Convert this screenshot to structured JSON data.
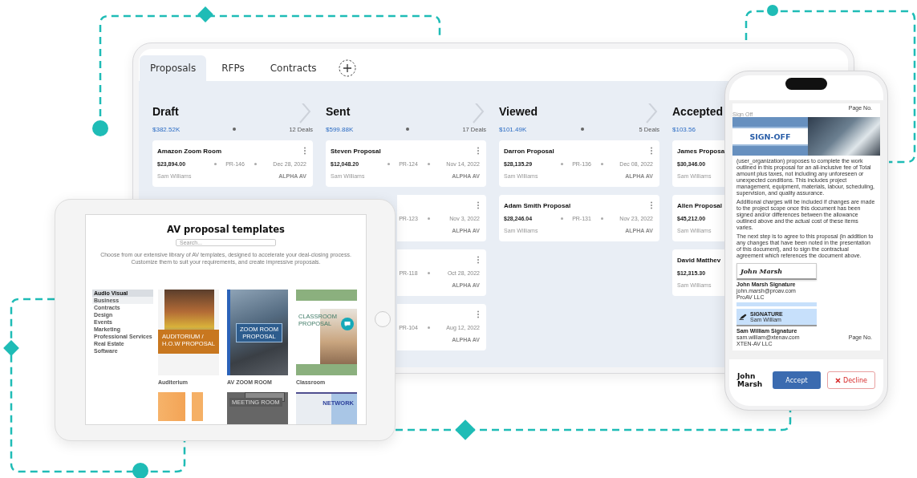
{
  "laptop": {
    "tabs": [
      {
        "label": "Proposals",
        "selected": true
      },
      {
        "label": "RFPs",
        "selected": false
      },
      {
        "label": "Contracts",
        "selected": false
      }
    ],
    "columns": [
      {
        "title": "Draft",
        "total": "$382.52K",
        "deals": "12 Deals",
        "cards": [
          {
            "title": "Amazon Zoom Room",
            "amount": "$23,894.00",
            "ref": "PR-146",
            "date": "Dec 28, 2022",
            "owner": "Sam Williams",
            "company": "ALPHA AV"
          }
        ]
      },
      {
        "title": "Sent",
        "total": "$599.88K",
        "deals": "17 Deals",
        "cards": [
          {
            "title": "Steven Proposal",
            "amount": "$12,048.20",
            "ref": "PR-124",
            "date": "Nov 14, 2022",
            "owner": "Sam Williams",
            "company": "ALPHA AV"
          },
          {
            "ref": "PR-123",
            "date": "Nov 3, 2022",
            "company": "ALPHA AV"
          },
          {
            "ref": "PR-118",
            "date": "Oct 28, 2022",
            "company": "ALPHA AV"
          },
          {
            "ref": "PR-104",
            "date": "Aug 12, 2022",
            "company": "ALPHA AV"
          }
        ]
      },
      {
        "title": "Viewed",
        "total": "$101.49K",
        "deals": "5 Deals",
        "cards": [
          {
            "title": "Darron Proposal",
            "amount": "$28,135.29",
            "ref": "PR-136",
            "date": "Dec 08, 2022",
            "owner": "Sam Williams",
            "company": "ALPHA AV"
          },
          {
            "title": "Adam Smith Proposal",
            "amount": "$28,246.04",
            "ref": "PR-131",
            "date": "Nov 23, 2022",
            "owner": "Sam Williams",
            "company": "ALPHA AV"
          }
        ]
      },
      {
        "title": "Accepted",
        "total": "$103.56",
        "cards": [
          {
            "title": "James Proposa",
            "amount": "$30,346.00",
            "owner": "Sam Williams"
          },
          {
            "title": "Allen Proposal",
            "amount": "$45,212.00",
            "owner": "Sam Williams"
          },
          {
            "title": "David Matthev",
            "amount": "$12,315.30",
            "owner": "Sam Williams"
          }
        ]
      }
    ]
  },
  "tablet": {
    "title": "AV proposal templates",
    "search": {
      "placeholder": "Search..."
    },
    "description": "Choose from our extensive library of AV templates, designed to accelerate your deal-closing process. Customize them to suit your requirements, and create impressive proposals.",
    "categories": [
      {
        "label": "Audio Visual",
        "selected": true,
        "hovered": false
      },
      {
        "label": "Business",
        "selected": false,
        "hovered": true
      },
      {
        "label": "Contracts",
        "selected": false,
        "hovered": false
      },
      {
        "label": "Design",
        "selected": false,
        "hovered": false
      },
      {
        "label": "Events",
        "selected": false,
        "hovered": false
      },
      {
        "label": "Marketing",
        "selected": false,
        "hovered": false
      },
      {
        "label": "Professional Services",
        "selected": false,
        "hovered": false
      },
      {
        "label": "Real Estate",
        "selected": false,
        "hovered": false
      },
      {
        "label": "Software",
        "selected": false,
        "hovered": false
      }
    ],
    "templates": [
      {
        "kind": "auditorium",
        "cover_text": "AUDITORIUM / H.O.W PROPOSAL",
        "name": "Auditerium"
      },
      {
        "kind": "zoom",
        "cover_text": "ZOOM ROOM PROPOSAL",
        "name": "AV ZOOM ROOM"
      },
      {
        "kind": "classroom",
        "cover_text": "CLASSROOM PROPOSAL",
        "name": "Classroom"
      },
      {
        "kind": "office"
      },
      {
        "kind": "meeting",
        "cover_text": "MEETING ROOM"
      },
      {
        "kind": "network",
        "cover_text": "NETWORK"
      }
    ]
  },
  "phone": {
    "document": {
      "page_label_top": "Page No.",
      "section_label": "Sign Off",
      "banner_title": "SIGN-OFF",
      "paragraphs": [
        "(user_organization) proposes to complete the work outlined in this proposal for an all-inclusive fee of Total amount plus taxes, not including any unforeseen or unexpected conditions. This includes project management, equipment, materials, labour, scheduling, supervision, and quality assurance.",
        "Additional charges will be included if changes are made to the project scope once this document has been signed and/or differences between the allowance outlined above and the actual cost of these items varies.",
        "The next step is to agree to this proposal (in addition to any changes that have been noted in the presentation of this document), and to sign the contractual agreement which references the document above."
      ],
      "signers": [
        {
          "kind": "drawn",
          "signature": "John Marsh",
          "caption": "John Marsh Signature",
          "email": "john.marsh@proav.com",
          "company": "ProAV LLC"
        },
        {
          "kind": "stamp",
          "stamp_title": "SIGNATURE",
          "stamp_name": "Sam William",
          "caption": "Sam William Signature",
          "email": "sam.william@xtenav.com",
          "company": "XTEN-AV LLC"
        }
      ],
      "page_label_bottom": "Page No."
    },
    "signer_name": "John Marsh",
    "accept": "Accept",
    "decline": "Decline"
  }
}
